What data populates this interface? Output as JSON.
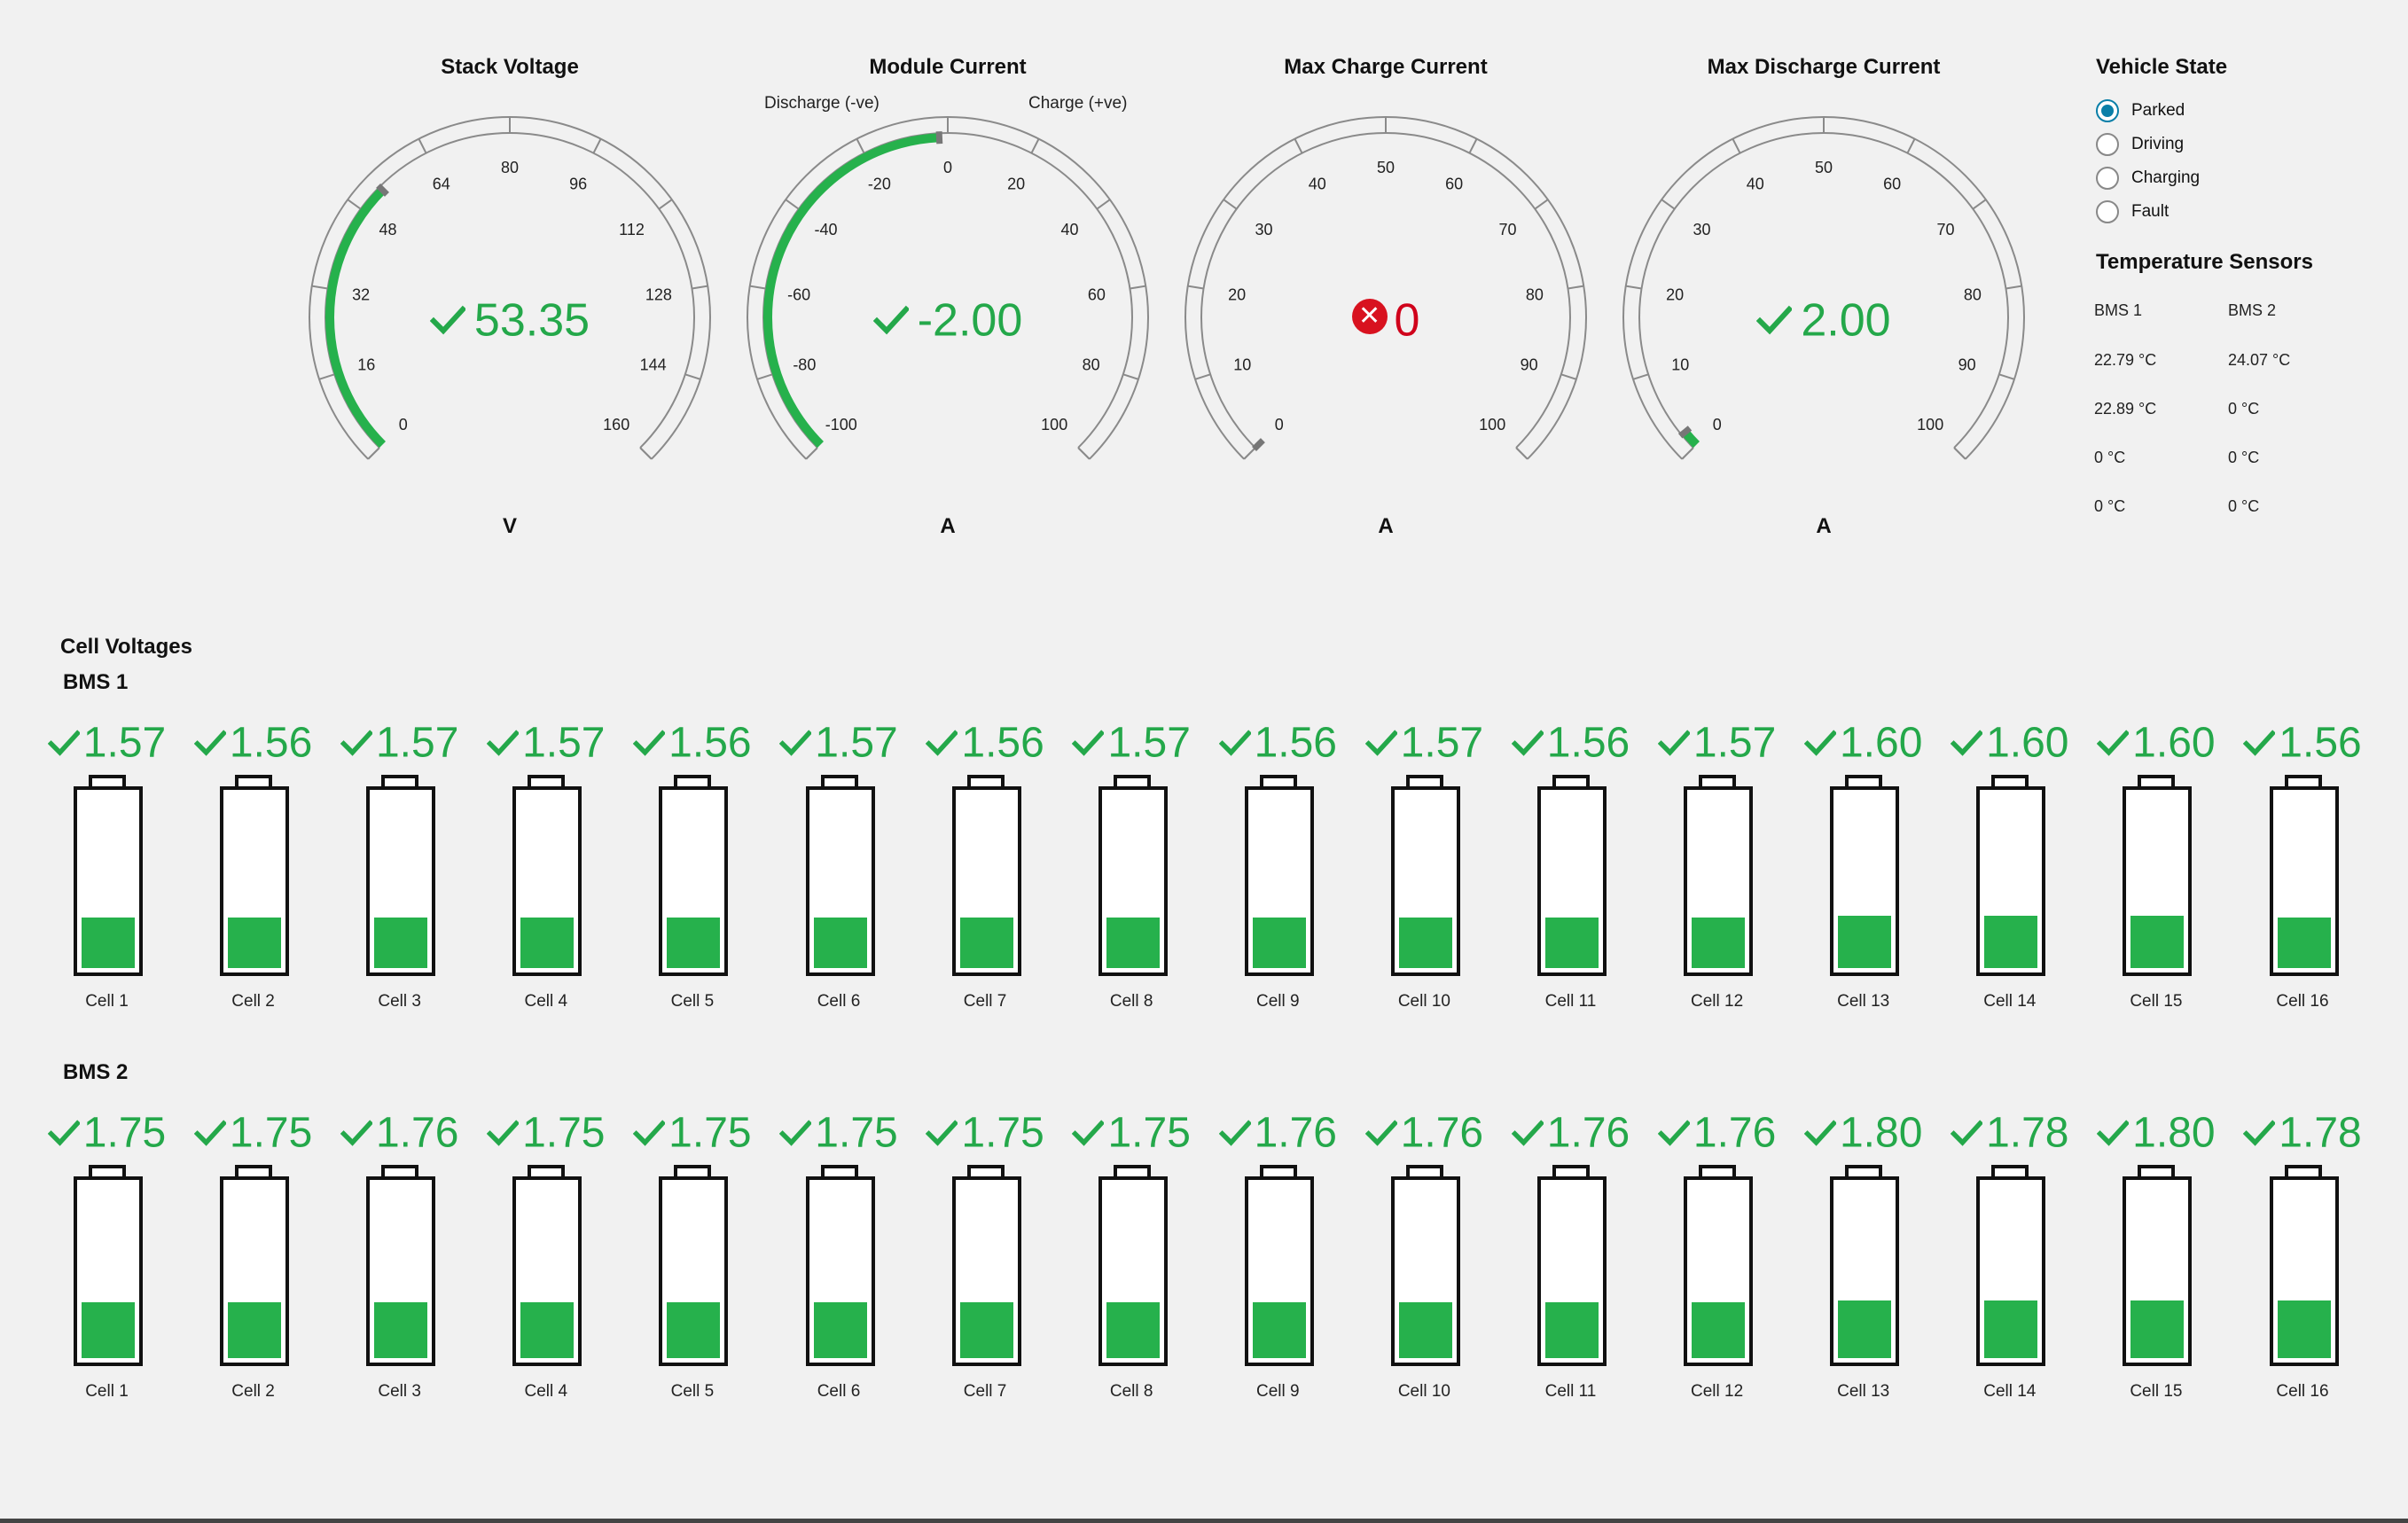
{
  "gauges": [
    {
      "title": "Stack Voltage",
      "unit": "V",
      "value": "53.35",
      "value_num": 53.35,
      "status": "ok",
      "min": 0,
      "max": 160,
      "ticks": [
        0,
        16,
        32,
        48,
        64,
        80,
        96,
        112,
        128,
        144,
        160
      ],
      "fill_from": 0,
      "fill_to": 53.35,
      "side_left": "",
      "side_right": ""
    },
    {
      "title": "Module Current",
      "unit": "A",
      "value": "-2.00",
      "value_num": -2.0,
      "status": "ok",
      "min": -100,
      "max": 100,
      "ticks": [
        -100,
        -80,
        -60,
        -40,
        -20,
        0,
        20,
        40,
        60,
        80,
        100
      ],
      "fill_from": -100,
      "fill_to": -2.0,
      "side_left": "Discharge (-ve)",
      "side_right": "Charge (+ve)"
    },
    {
      "title": "Max Charge Current",
      "unit": "A",
      "value": "0",
      "value_num": 0,
      "status": "error",
      "min": 0,
      "max": 100,
      "ticks": [
        0,
        10,
        20,
        30,
        40,
        50,
        60,
        70,
        80,
        90,
        100
      ],
      "fill_from": 0,
      "fill_to": 0,
      "side_left": "",
      "side_right": ""
    },
    {
      "title": "Max Discharge Current",
      "unit": "A",
      "value": "2.00",
      "value_num": 2.0,
      "status": "ok",
      "min": 0,
      "max": 100,
      "ticks": [
        0,
        10,
        20,
        30,
        40,
        50,
        60,
        70,
        80,
        90,
        100
      ],
      "fill_from": 0,
      "fill_to": 2.0,
      "side_left": "",
      "side_right": ""
    }
  ],
  "vehicle_state": {
    "title": "Vehicle State",
    "options": [
      "Parked",
      "Driving",
      "Charging",
      "Fault"
    ],
    "selected": "Parked"
  },
  "temperature": {
    "title": "Temperature Sensors",
    "headers": [
      "BMS 1",
      "BMS 2"
    ],
    "rows": [
      [
        "22.79 °C",
        "24.07 °C"
      ],
      [
        "22.89 °C",
        "0 °C"
      ],
      [
        "0 °C",
        "0 °C"
      ],
      [
        "0 °C",
        "0 °C"
      ]
    ]
  },
  "cell_voltages": {
    "title": "Cell Voltages",
    "banks": [
      {
        "name": "BMS 1",
        "cells": [
          {
            "label": "Cell 1",
            "value": "1.57",
            "level": 0.29
          },
          {
            "label": "Cell 2",
            "value": "1.56",
            "level": 0.29
          },
          {
            "label": "Cell 3",
            "value": "1.57",
            "level": 0.29
          },
          {
            "label": "Cell 4",
            "value": "1.57",
            "level": 0.29
          },
          {
            "label": "Cell 5",
            "value": "1.56",
            "level": 0.29
          },
          {
            "label": "Cell 6",
            "value": "1.57",
            "level": 0.29
          },
          {
            "label": "Cell 7",
            "value": "1.56",
            "level": 0.29
          },
          {
            "label": "Cell 8",
            "value": "1.57",
            "level": 0.29
          },
          {
            "label": "Cell 9",
            "value": "1.56",
            "level": 0.29
          },
          {
            "label": "Cell 10",
            "value": "1.57",
            "level": 0.29
          },
          {
            "label": "Cell 11",
            "value": "1.56",
            "level": 0.29
          },
          {
            "label": "Cell 12",
            "value": "1.57",
            "level": 0.29
          },
          {
            "label": "Cell 13",
            "value": "1.60",
            "level": 0.3
          },
          {
            "label": "Cell 14",
            "value": "1.60",
            "level": 0.3
          },
          {
            "label": "Cell 15",
            "value": "1.60",
            "level": 0.3
          },
          {
            "label": "Cell 16",
            "value": "1.56",
            "level": 0.29
          }
        ]
      },
      {
        "name": "BMS 2",
        "cells": [
          {
            "label": "Cell 1",
            "value": "1.75",
            "level": 0.32
          },
          {
            "label": "Cell 2",
            "value": "1.75",
            "level": 0.32
          },
          {
            "label": "Cell 3",
            "value": "1.76",
            "level": 0.32
          },
          {
            "label": "Cell 4",
            "value": "1.75",
            "level": 0.32
          },
          {
            "label": "Cell 5",
            "value": "1.75",
            "level": 0.32
          },
          {
            "label": "Cell 6",
            "value": "1.75",
            "level": 0.32
          },
          {
            "label": "Cell 7",
            "value": "1.75",
            "level": 0.32
          },
          {
            "label": "Cell 8",
            "value": "1.75",
            "level": 0.32
          },
          {
            "label": "Cell 9",
            "value": "1.76",
            "level": 0.32
          },
          {
            "label": "Cell 10",
            "value": "1.76",
            "level": 0.32
          },
          {
            "label": "Cell 11",
            "value": "1.76",
            "level": 0.32
          },
          {
            "label": "Cell 12",
            "value": "1.76",
            "level": 0.32
          },
          {
            "label": "Cell 13",
            "value": "1.80",
            "level": 0.33
          },
          {
            "label": "Cell 14",
            "value": "1.78",
            "level": 0.33
          },
          {
            "label": "Cell 15",
            "value": "1.80",
            "level": 0.33
          },
          {
            "label": "Cell 16",
            "value": "1.78",
            "level": 0.33
          }
        ]
      }
    ]
  },
  "colors": {
    "ok": "#24a84a",
    "error": "#d8121f",
    "battery_fill": "#26b14c",
    "radio_selected": "#0a7fa8"
  }
}
